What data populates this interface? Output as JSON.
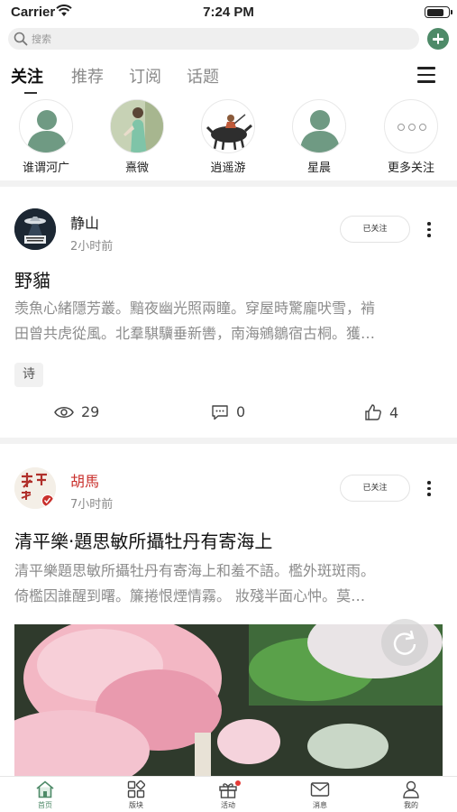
{
  "status_bar": {
    "carrier": "Carrier",
    "time": "7:24 PM",
    "battery_level": 0.7
  },
  "search": {
    "placeholder": "搜索"
  },
  "tabs": [
    {
      "label": "关注",
      "active": true
    },
    {
      "label": "推荐",
      "active": false
    },
    {
      "label": "订阅",
      "active": false
    },
    {
      "label": "话题",
      "active": false
    }
  ],
  "follows": [
    {
      "name": "谁谓河广",
      "avatar": "default-person-avatar"
    },
    {
      "name": "熹微",
      "avatar": "photo-person-avatar"
    },
    {
      "name": "逍遥游",
      "avatar": "ink-ox-rider-avatar"
    },
    {
      "name": "星晨",
      "avatar": "default-person-avatar"
    },
    {
      "name": "更多关注",
      "avatar": "more-dots-icon"
    }
  ],
  "posts": [
    {
      "author": "静山",
      "time": "2小时前",
      "follow_label": "已关注",
      "title": "野貓",
      "body_lines": [
        "羡魚心緒隱芳叢。黯夜幽光照兩瞳。穿屋時驚龐吠雪，褃",
        "田曾共虎從風。北羣騏驥垂新轡，南海鵷鶵宿古桐。獲…"
      ],
      "tag": "诗",
      "views": "29",
      "comments": "0",
      "likes": "4"
    },
    {
      "author": "胡馬",
      "time": "7小时前",
      "follow_label": "已关注",
      "title": "清平樂·題思敏所攝牡丹有寄海上",
      "body_lines": [
        "清平樂題思敏所攝牡丹有寄海上和羞不語。檻外斑斑雨。",
        "倚檻因誰醒到曙。簾捲恨煙情霧。 妝殘半面心忡。莫…"
      ]
    }
  ],
  "bottom_nav": [
    {
      "label": "首页",
      "icon": "home-icon",
      "active": true
    },
    {
      "label": "版块",
      "icon": "grid-icon",
      "active": false
    },
    {
      "label": "活动",
      "icon": "gift-icon",
      "active": false
    },
    {
      "label": "消息",
      "icon": "mail-icon",
      "active": false
    },
    {
      "label": "我的",
      "icon": "person-icon",
      "active": false
    }
  ],
  "colors": {
    "accent": "#4e8a68",
    "author_red": "#c9302c",
    "muted": "#8c8c8c"
  }
}
